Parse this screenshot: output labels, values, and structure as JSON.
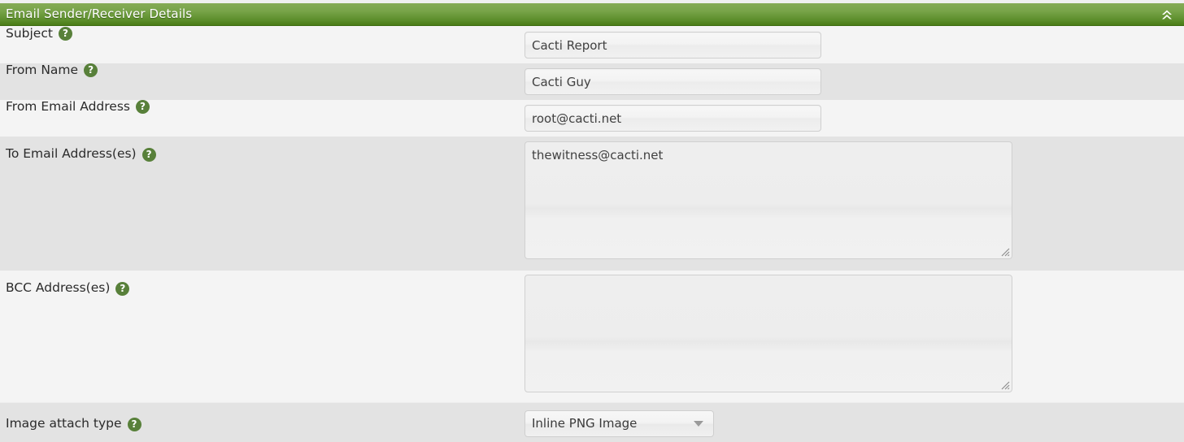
{
  "panel": {
    "title": "Email Sender/Receiver Details",
    "collapse_icon": "double-chevron-up-icon",
    "header_gradient_top": "#86ab56",
    "header_gradient_bottom": "#4a7c16",
    "header_text_color": "#ffffff"
  },
  "help_icon_glyph": "?",
  "rows": [
    {
      "label": "Subject",
      "help": "?",
      "control": "text",
      "value": "Cacti Report",
      "placeholder": "",
      "shade": "light"
    },
    {
      "label": "From Name",
      "help": "?",
      "control": "text",
      "value": "Cacti Guy",
      "placeholder": "",
      "shade": "dark"
    },
    {
      "label": "From Email Address",
      "help": "?",
      "control": "text",
      "value": "root@cacti.net",
      "placeholder": "",
      "shade": "light"
    },
    {
      "label": "To Email Address(es)",
      "help": "?",
      "control": "textarea",
      "value": "thewitness@cacti.net",
      "placeholder": "",
      "shade": "dark"
    },
    {
      "label": "BCC Address(es)",
      "help": "?",
      "control": "textarea",
      "value": "",
      "placeholder": "",
      "shade": "light"
    },
    {
      "label": "Image attach type",
      "help": "?",
      "control": "select",
      "value": "Inline PNG Image",
      "placeholder": "",
      "shade": "dark"
    }
  ],
  "colors": {
    "row_light": "#f4f4f4",
    "row_dark": "#e3e3e3",
    "label_text": "#2b2b2b",
    "field_text": "#414141",
    "help_badge": "#58803a",
    "input_border": "#cfcfcf"
  }
}
